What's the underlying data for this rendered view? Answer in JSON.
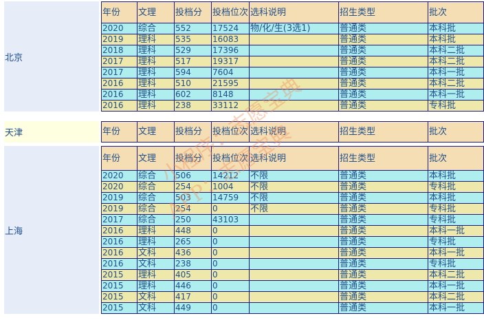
{
  "headers": [
    "年份",
    "文理",
    "投档分",
    "投档位次",
    "选科说明",
    "招生类型",
    "批次"
  ],
  "provinces": [
    {
      "name": "北京",
      "rows": [
        [
          "2020",
          "综合",
          "552",
          "17524",
          "物/化/生(3选1)",
          "普通类",
          "本科批"
        ],
        [
          "2019",
          "理科",
          "535",
          "16083",
          "",
          "普通类",
          "本科批"
        ],
        [
          "2018",
          "理科",
          "529",
          "17396",
          "",
          "普通类",
          "本科二批"
        ],
        [
          "2017",
          "理科",
          "517",
          "19317",
          "",
          "普通类",
          "本科二批"
        ],
        [
          "2017",
          "理科",
          "594",
          "7604",
          "",
          "普通类",
          "本科一批"
        ],
        [
          "2016",
          "理科",
          "510",
          "21595",
          "",
          "普通类",
          "本科二批"
        ],
        [
          "2016",
          "理科",
          "602",
          "8148",
          "",
          "普通类",
          "本科一批"
        ],
        [
          "2016",
          "理科",
          "238",
          "33112",
          "",
          "普通类",
          "专科批"
        ]
      ]
    },
    {
      "name": "天津",
      "rows": []
    },
    {
      "name": "上海",
      "rows": [
        [
          "2020",
          "综合",
          "506",
          "14212",
          "不限",
          "普通类",
          "本科批"
        ],
        [
          "2020",
          "综合",
          "254",
          "1004",
          "不限",
          "普通类",
          "专科批"
        ],
        [
          "2019",
          "综合",
          "503",
          "14759",
          "不限",
          "普通类",
          "本科批"
        ],
        [
          "2019",
          "综合",
          "254",
          "0",
          "不限",
          "普通类",
          "专科批"
        ],
        [
          "2017",
          "综合",
          "250",
          "43103",
          "",
          "普通类",
          "专科批"
        ],
        [
          "2016",
          "理科",
          "448",
          "0",
          "",
          "普通类",
          "本科一批"
        ],
        [
          "2016",
          "理科",
          "265",
          "0",
          "",
          "普通类",
          "专科批"
        ],
        [
          "2016",
          "文科",
          "436",
          "0",
          "",
          "普通类",
          "本科一批"
        ],
        [
          "2016",
          "文科",
          "238",
          "0",
          "",
          "普通类",
          "专科批"
        ],
        [
          "2015",
          "理科",
          "405",
          "0",
          "",
          "普通类",
          "本科二批"
        ],
        [
          "2015",
          "理科",
          "446",
          "0",
          "",
          "普通类",
          "本科一批"
        ],
        [
          "2015",
          "文科",
          "417",
          "0",
          "",
          "普通类",
          "本科二批"
        ],
        [
          "2015",
          "文科",
          "449",
          "0",
          "",
          "普通类",
          "本科一批"
        ]
      ]
    }
  ],
  "watermark": {
    "line1": "小程序：志愿宝典",
    "line2": "APP：志愿宝典"
  }
}
